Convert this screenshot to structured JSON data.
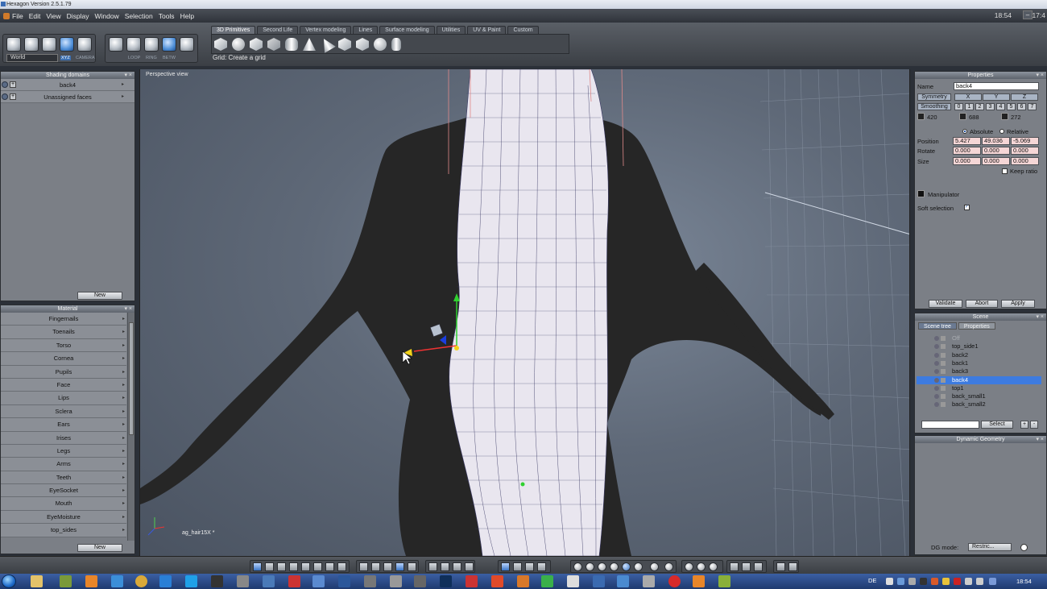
{
  "window": {
    "title": "Hexagon Version 2.5.1.79",
    "clock_top_left": "18:54",
    "clock_top_right": "17:4"
  },
  "menu": [
    "File",
    "Edit",
    "View",
    "Display",
    "Window",
    "Selection",
    "Tools",
    "Help"
  ],
  "toolbar": {
    "world_select": "World",
    "mini_labels_left": [
      "XYZ",
      "CAMERA"
    ],
    "mini_labels_right": [
      "LOOP",
      "RING",
      "BETW"
    ],
    "tabs": [
      "3D Primitives",
      "Second Life",
      "Vertex modeling",
      "Lines",
      "Surface modeling",
      "Utilities",
      "UV & Paint",
      "Custom"
    ],
    "active_tab": "3D Primitives",
    "status": "Grid: Create a grid"
  },
  "shading_domains": {
    "header": "Shading domains",
    "items": [
      "back4",
      "Unassigned faces"
    ],
    "new_label": "New"
  },
  "material": {
    "header": "Material",
    "items": [
      "Fingernails",
      "Toenails",
      "Torso",
      "Cornea",
      "Pupils",
      "Face",
      "Lips",
      "Sclera",
      "Ears",
      "Irises",
      "Legs",
      "Arms",
      "Teeth",
      "EyeSocket",
      "Mouth",
      "EyeMoisture",
      "top_sides"
    ],
    "new_label": "New"
  },
  "viewport": {
    "label": "Perspective view",
    "object_label": "ag_hair15X *"
  },
  "properties": {
    "header": "Properties",
    "name_label": "Name",
    "name_value": "back4",
    "symmetry_label": "Symmetry",
    "axes": [
      "X",
      "Y",
      "Z"
    ],
    "smoothing_label": "Smoothing",
    "smoothing_levels": [
      "0",
      "1",
      "2",
      "3",
      "4",
      "5",
      "6",
      "7"
    ],
    "stats": [
      "420",
      "688",
      "272"
    ],
    "absolute_label": "Absolute",
    "relative_label": "Relative",
    "position_label": "Position",
    "rotate_label": "Rotate",
    "size_label": "Size",
    "position": [
      "5.427",
      "49.036",
      "-5.069"
    ],
    "rotate": [
      "0.000",
      "0.000",
      "0.000"
    ],
    "size": [
      "0.000",
      "0.000",
      "0.000"
    ],
    "keep_ratio_label": "Keep ratio",
    "manipulator_label": "Manipulator",
    "soft_selection_label": "Soft selection",
    "validate_label": "Validate",
    "abort_label": "Abort",
    "apply_label": "Apply"
  },
  "scene": {
    "header": "Scene",
    "tabs": [
      "Scene tree",
      "Properties"
    ],
    "items": [
      "Off",
      "top_side1",
      "back2",
      "back1",
      "back3",
      "back4",
      "top1",
      "back_small1",
      "back_small2"
    ],
    "selected": "back4",
    "select_label": "Select"
  },
  "dynamic_geometry": {
    "header": "Dynamic Geometry",
    "mode_label": "DG mode:",
    "mode_value": "Restric..."
  },
  "taskbar": {
    "language": "DE",
    "clock": "18:54"
  },
  "colors": {
    "accent": "#3d7be0",
    "panel": "#7b7f86",
    "viewport_bg": "#5f6978",
    "selection": "#3d7be0"
  }
}
